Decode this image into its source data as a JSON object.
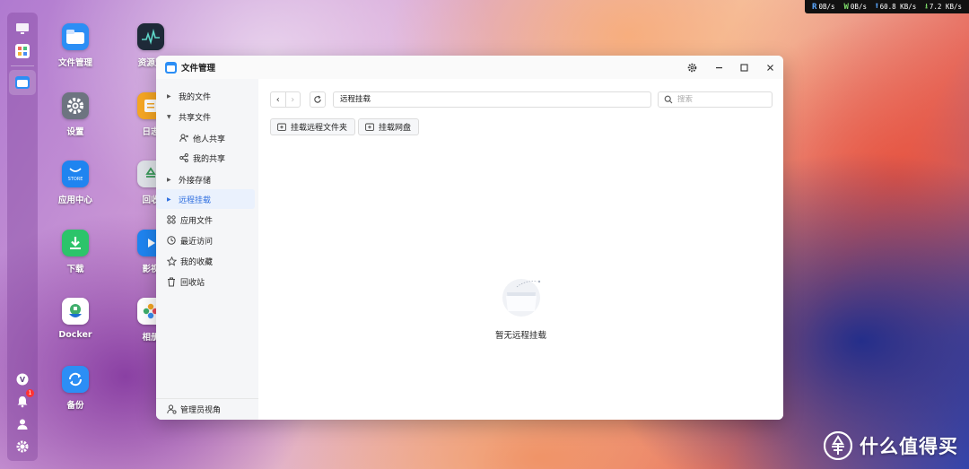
{
  "status_bar": {
    "read_key": "R",
    "read_value": "0B/s",
    "write_key": "W",
    "write_value": "0B/s",
    "upload_value": "60.8 KB/s",
    "download_value": "7.2 KB/s"
  },
  "dock": {
    "items": [
      "monitor-icon",
      "app-grid-icon",
      "file-manager-icon",
      "logo-icon",
      "bell-icon",
      "user-icon",
      "gear-icon"
    ],
    "notification_count": "1"
  },
  "desktop": {
    "icons": [
      {
        "label": "文件管理",
        "icon": "folder-icon"
      },
      {
        "label": "设置",
        "icon": "gear-icon"
      },
      {
        "label": "应用中心",
        "icon": "store-icon"
      },
      {
        "label": "下载",
        "icon": "download-icon"
      },
      {
        "label": "Docker",
        "icon": "docker-icon"
      },
      {
        "label": "备份",
        "icon": "backup-icon"
      },
      {
        "label": "资源监",
        "icon": "monitor-chart-icon"
      },
      {
        "label": "日志",
        "icon": "log-icon"
      },
      {
        "label": "回收",
        "icon": "recycle-icon"
      },
      {
        "label": "影视",
        "icon": "video-icon"
      },
      {
        "label": "相册",
        "icon": "photos-icon"
      }
    ],
    "store_badge_text": "STORE"
  },
  "window": {
    "title": "文件管理",
    "sidebar": {
      "items": [
        {
          "label": "我的文件",
          "kind": "caret"
        },
        {
          "label": "共享文件",
          "kind": "caret-open"
        },
        {
          "label": "他人共享",
          "kind": "child",
          "icon": "users-icon"
        },
        {
          "label": "我的共享",
          "kind": "child",
          "icon": "share-icon"
        },
        {
          "label": "外接存储",
          "kind": "caret"
        },
        {
          "label": "远程挂载",
          "kind": "caret",
          "active": true
        },
        {
          "label": "应用文件",
          "kind": "icon",
          "icon": "apps-icon"
        },
        {
          "label": "最近访问",
          "kind": "icon",
          "icon": "clock-icon"
        },
        {
          "label": "我的收藏",
          "kind": "icon",
          "icon": "star-icon"
        },
        {
          "label": "回收站",
          "kind": "icon",
          "icon": "trash-icon"
        }
      ],
      "bottom_label": "管理员视角"
    },
    "toolbar": {
      "path": "远程挂载",
      "search_placeholder": "搜索",
      "mount_folder_label": "挂载远程文件夹",
      "mount_drive_label": "挂载网盘"
    },
    "empty_state": "暂无远程挂载"
  },
  "watermark": "什么值得买",
  "colors": {
    "accent": "#2f6fe0",
    "status_read": "#5aa8ff",
    "status_write": "#7ddc6a"
  }
}
